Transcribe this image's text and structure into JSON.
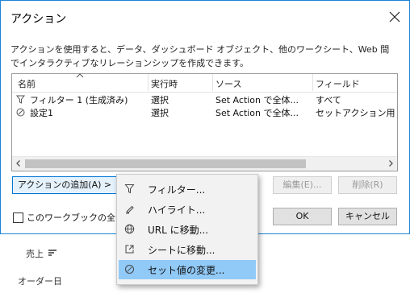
{
  "dialog": {
    "title": "アクション",
    "description": "アクションを使用すると、データ、ダッシュボード オブジェクト、他のワークシート、Web 間でインタラクティブなリレーションシップを作成できます。"
  },
  "table": {
    "columns": [
      "名前",
      "実行時",
      "ソース",
      "フィールド"
    ],
    "rows": [
      {
        "icon": "filter-icon",
        "name": "フィルター 1 (生成済み)",
        "run_on": "選択",
        "source": "Set Action で全体...",
        "field": "すべて"
      },
      {
        "icon": "set-icon",
        "name": "設定1",
        "run_on": "選択",
        "source": "Set Action で全体...",
        "field": "セットアクション用 選"
      }
    ]
  },
  "buttons": {
    "add_action": "アクションの追加(A) >",
    "edit": "編集(E)...",
    "delete": "削除(R)",
    "ok": "OK",
    "cancel": "キャンセル"
  },
  "checkbox": {
    "label": "このワークブックの全ジ",
    "checked": false
  },
  "menu": {
    "items": [
      {
        "icon": "filter-icon",
        "label": "フィルター..."
      },
      {
        "icon": "highlight-icon",
        "label": "ハイライト..."
      },
      {
        "icon": "globe-icon",
        "label": "URL に移動..."
      },
      {
        "icon": "sheet-link-icon",
        "label": "シートに移動..."
      },
      {
        "icon": "set-icon",
        "label": "セット値の変更...",
        "highlighted": true
      }
    ]
  },
  "background": {
    "labels": [
      "売上",
      "オーダー日"
    ]
  },
  "colors": {
    "dialog_border": "#1883d7",
    "menu_highlight": "#91c9f7",
    "primary_button_border": "#0078d7"
  }
}
